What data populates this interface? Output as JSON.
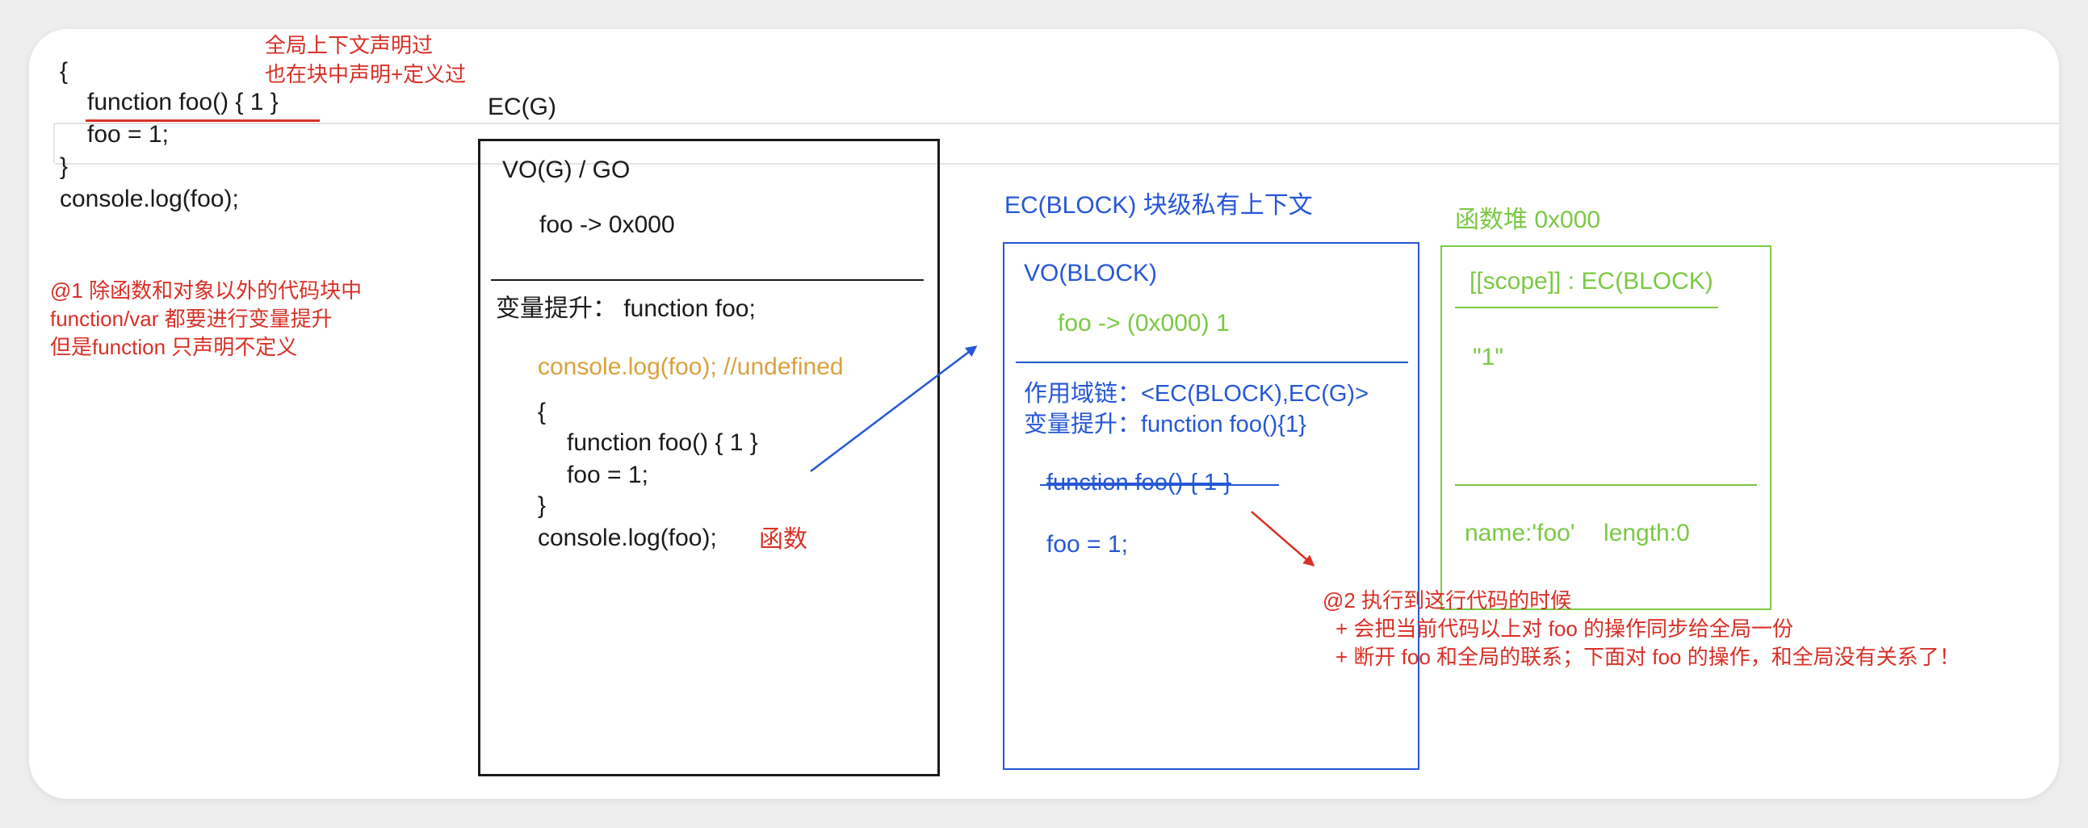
{
  "code_snippet": {
    "line1": "{",
    "line2": "function foo() { 1 }",
    "line3": "foo = 1;",
    "line4": "}",
    "line5": "console.log(foo);"
  },
  "top_note": {
    "line1": "全局上下文声明过",
    "line2": "也在块中声明+定义过"
  },
  "note1": {
    "line1": "@1 除函数和对象以外的代码块中",
    "line2": "function/var 都要进行变量提升",
    "line3": "但是function 只声明不定义"
  },
  "ecg": {
    "title": "EC(G)",
    "vo_title": "VO(G) / GO",
    "vo_entry": "foo -> 0x000",
    "hoist": "变量提升：  function foo;",
    "log_undefined": "console.log(foo); //undefined",
    "code1": "{",
    "code2": "function foo() { 1 }",
    "code3": "foo = 1;",
    "code4": "}",
    "code5": "console.log(foo);",
    "code5_note": "函数"
  },
  "ecblock": {
    "title": "EC(BLOCK) 块级私有上下文",
    "vo_title": "VO(BLOCK)",
    "vo_entry": "foo -> (0x000) 1",
    "scope_chain": "作用域链：<EC(BLOCK),EC(G)>",
    "hoist": "变量提升：function foo(){1}",
    "struck": "function foo() { 1 }",
    "assign": "foo = 1;"
  },
  "heap": {
    "title": "函数堆 0x000",
    "scope": "[[scope]] : EC(BLOCK)",
    "body": "\"1\"",
    "name": "name:'foo'",
    "length": "length:0"
  },
  "note2": {
    "line1": "@2 执行到这行代码的时候",
    "line2": "+ 会把当前代码以上对 foo 的操作同步给全局一份",
    "line3": "+ 断开 foo 和全局的联系；下面对 foo 的操作，和全局没有关系了！"
  },
  "colors": {
    "red": "#d93025",
    "blue": "#2557d6",
    "green": "#7ac943",
    "orange": "#d9a23c",
    "black": "#1a1a1a"
  }
}
